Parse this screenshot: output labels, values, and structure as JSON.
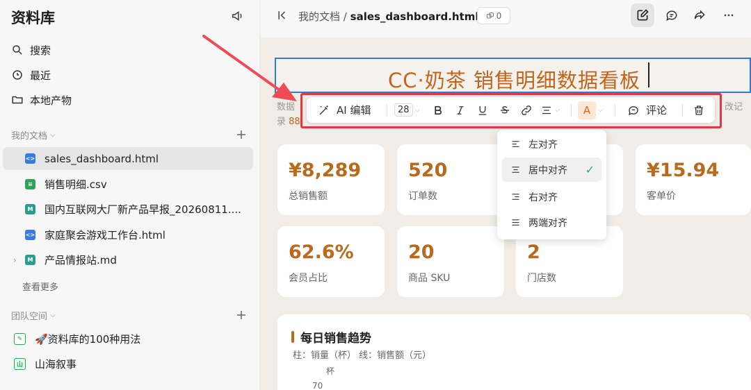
{
  "sidebar": {
    "title": "资料库",
    "nav": [
      {
        "label": "搜索",
        "icon": "search-icon"
      },
      {
        "label": "最近",
        "icon": "clock-icon"
      },
      {
        "label": "本地产物",
        "icon": "folder-icon"
      }
    ],
    "my_docs_header": "我的文档",
    "docs": [
      {
        "label": "sales_dashboard.html",
        "type": "html",
        "active": true
      },
      {
        "label": "销售明细.csv",
        "type": "csv"
      },
      {
        "label": "国内互联网大厂新产品早报_20260811....",
        "type": "md"
      },
      {
        "label": "家庭聚会游戏工作台.html",
        "type": "html"
      },
      {
        "label": "产品情报站.md",
        "type": "md",
        "collapsible": true
      }
    ],
    "see_more": "查看更多",
    "team_header": "团队空间",
    "team": [
      {
        "label": "🚀资料库的100种用法"
      },
      {
        "label": "山海叙事",
        "badge": "山"
      }
    ]
  },
  "header": {
    "breadcrumb_parent": "我的文档",
    "breadcrumb_sep": "/",
    "breadcrumb_current": "sales_dashboard.html",
    "link_count": "0"
  },
  "document": {
    "title": "CC·奶茶 销售明细数据看板",
    "subline1_prefix": "数据",
    "subline2_prefix": "录",
    "subline2_value": "88",
    "subline_right": "改记"
  },
  "toolbar": {
    "ai_edit": "AI 编辑",
    "font_size": "28",
    "comment": "评论",
    "color_letter": "A"
  },
  "align_menu": {
    "items": [
      {
        "label": "左对齐",
        "selected": false
      },
      {
        "label": "居中对齐",
        "selected": true
      },
      {
        "label": "右对齐",
        "selected": false
      },
      {
        "label": "两端对齐",
        "selected": false
      }
    ],
    "check": "✓"
  },
  "kpis": [
    {
      "value": "¥8,289",
      "label": "总销售额"
    },
    {
      "value": "520",
      "label": "订单数"
    },
    {
      "value": "¥15.94",
      "label": "客单价"
    },
    {
      "value": "62.6%",
      "label": "会员占比"
    },
    {
      "value": "20",
      "label": "商品 SKU"
    },
    {
      "value": "2",
      "label": "门店数"
    }
  ],
  "chart_panel": {
    "title": "每日销售趋势",
    "subtitle": "柱：销量（杯） 线：销售额（元）",
    "unit": "杯",
    "first_tick": "70"
  },
  "colors": {
    "accent": "#b86a1f",
    "title": "#c2651c",
    "annotation_red": "#e4373f",
    "selection_blue": "#2f7ad9"
  }
}
